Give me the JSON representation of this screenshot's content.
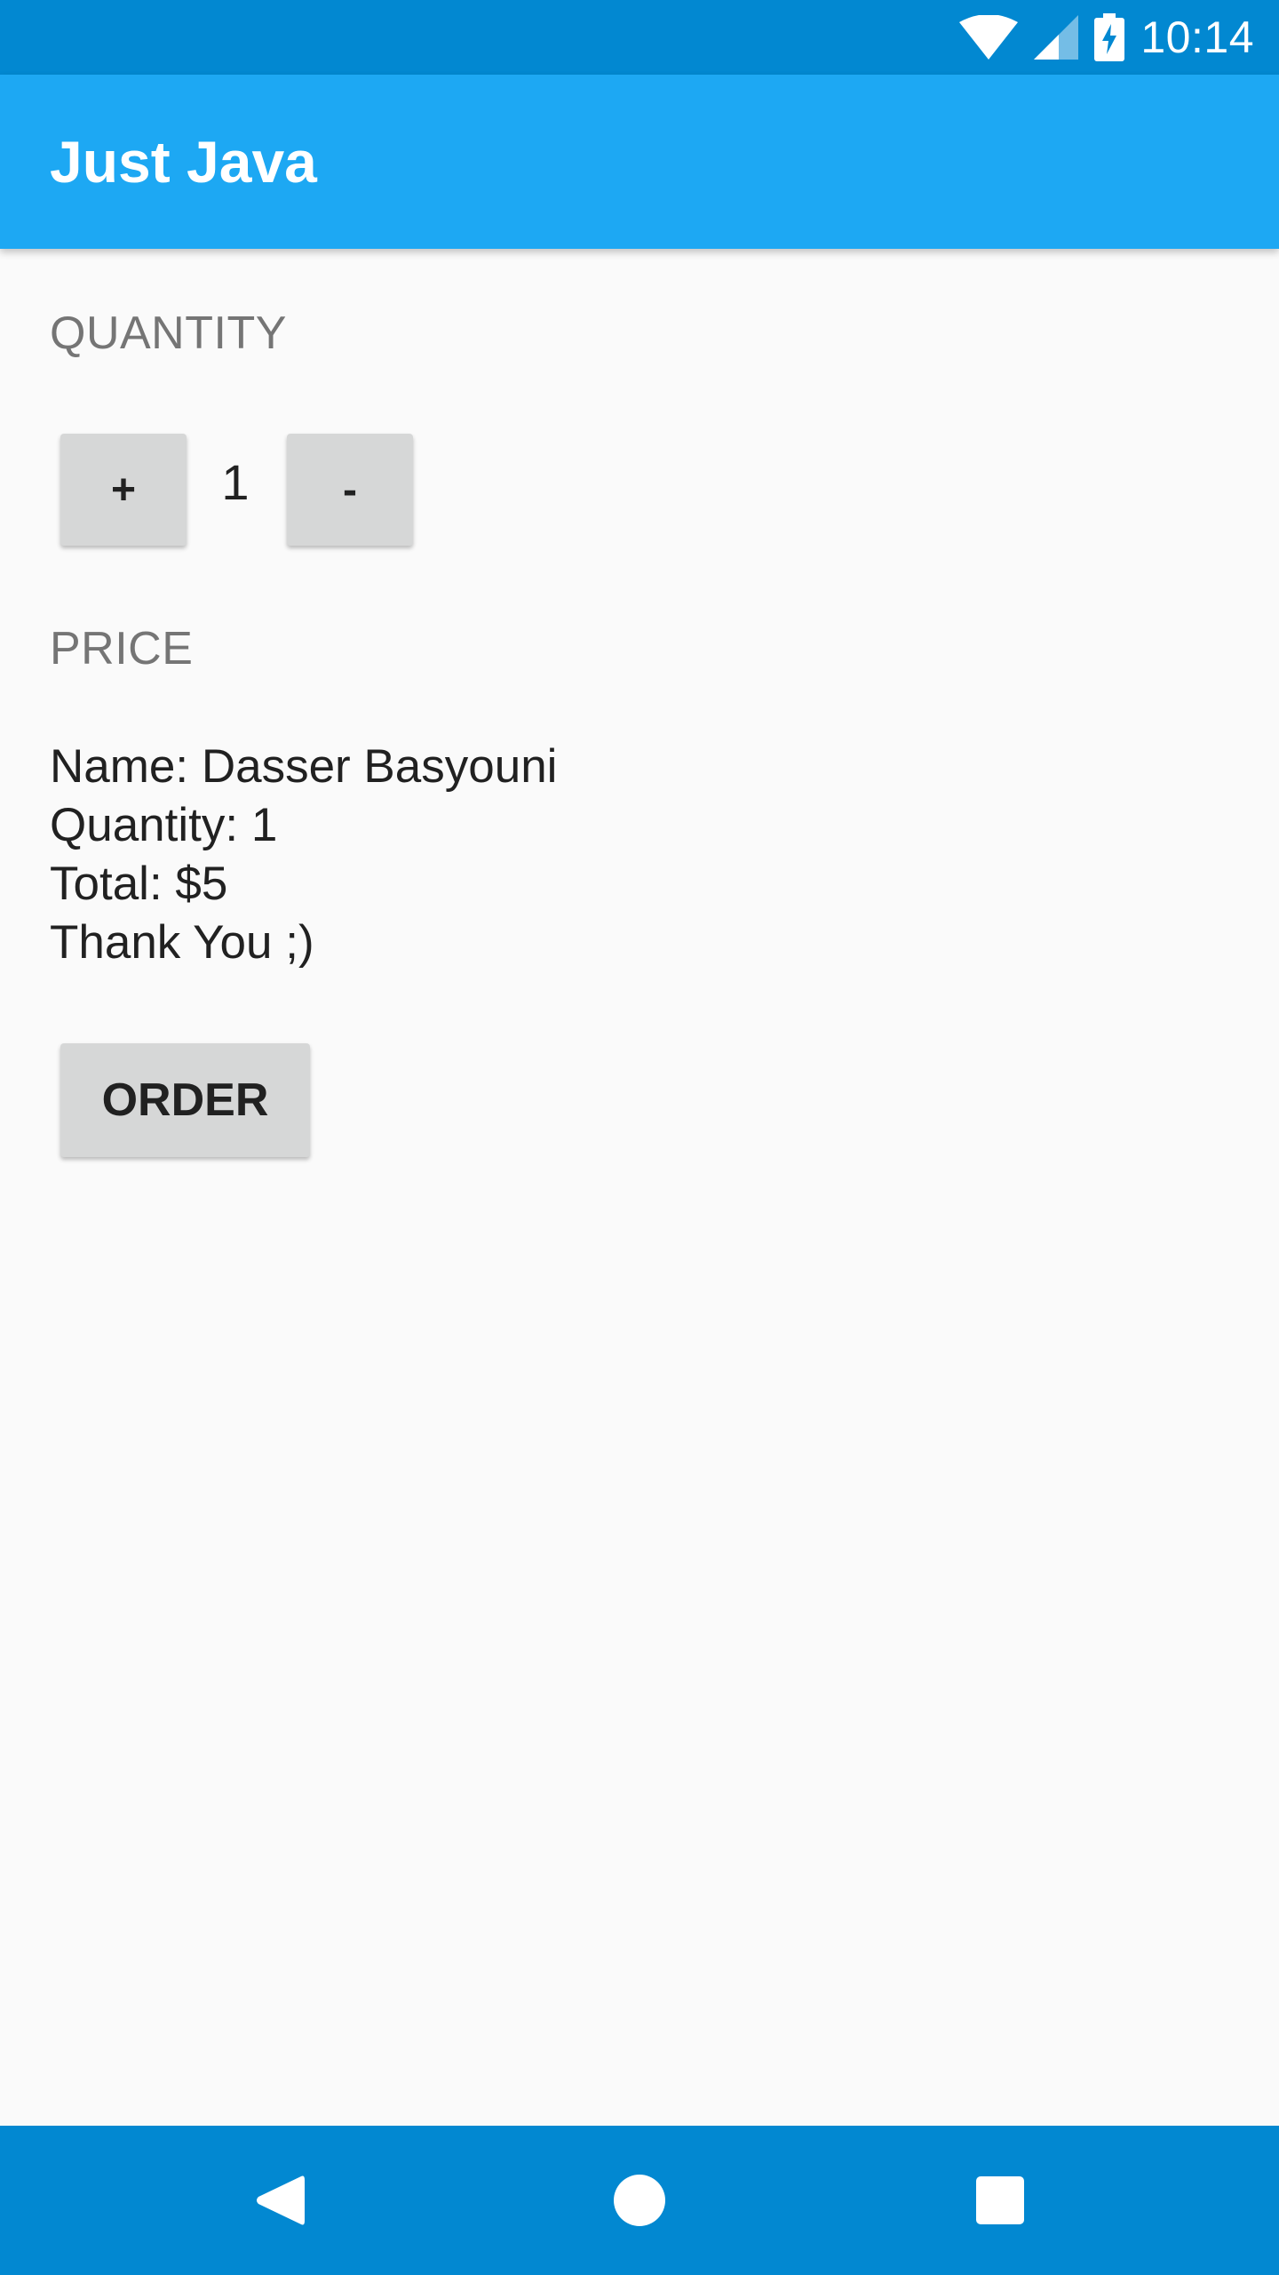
{
  "status_bar": {
    "time": "10:14",
    "icons": [
      "wifi-icon",
      "cell-signal-icon",
      "battery-charging-icon"
    ]
  },
  "app_bar": {
    "title": "Just Java"
  },
  "quantity_section": {
    "label": "QUANTITY",
    "increment_label": "+",
    "value": "1",
    "decrement_label": "-"
  },
  "price_section": {
    "label": "PRICE",
    "summary_lines": [
      "Name: Dasser Basyouni",
      "Quantity: 1",
      "Total: $5",
      "Thank You ;)"
    ]
  },
  "order_button": {
    "label": "ORDER"
  },
  "nav_bar": {
    "buttons": [
      "back-icon",
      "home-icon",
      "recents-icon"
    ]
  },
  "colors": {
    "status_bar": "#0288d1",
    "app_bar": "#1da8f3",
    "background": "#fafafa",
    "button": "#d6d7d7",
    "label_gray": "#757575"
  }
}
